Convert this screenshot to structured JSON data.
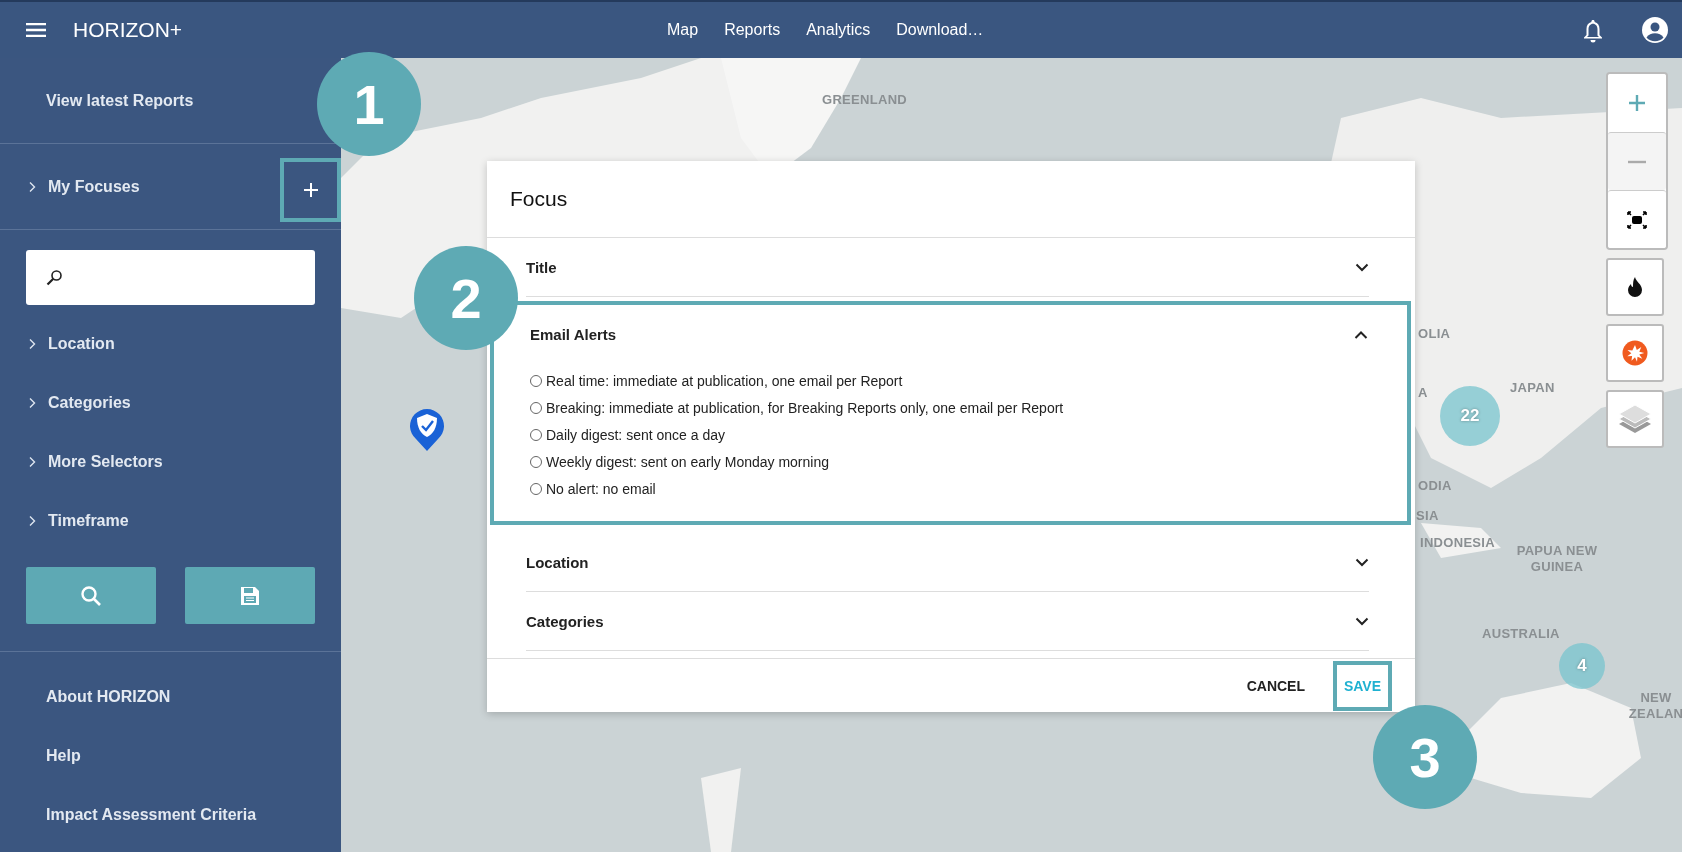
{
  "header": {
    "title": "HORIZON+",
    "nav": [
      "Map",
      "Reports",
      "Analytics",
      "Download…"
    ]
  },
  "sidebar": {
    "top_link": "View latest Reports",
    "focuses": {
      "label": "My Focuses",
      "expanded": false
    },
    "filters": [
      {
        "label": "Location",
        "expanded": false
      },
      {
        "label": "Categories",
        "expanded": false
      },
      {
        "label": "More Selectors",
        "expanded": false
      },
      {
        "label": "Timeframe",
        "expanded": false
      }
    ],
    "links": [
      "About HORIZON",
      "Help",
      "Impact Assessment Criteria"
    ]
  },
  "map": {
    "labels": [
      "GREENLAND",
      "OLIA",
      "A",
      "JAPAN",
      "ODIA",
      "SIA",
      "INDONESIA",
      "PAPUA NEW GUINEA",
      "AUSTRALIA",
      "NEW ZEALAN"
    ],
    "clusters": [
      "22",
      "4"
    ]
  },
  "dialog": {
    "title": "Focus",
    "sections": [
      {
        "title": "Title",
        "expanded": false
      },
      {
        "title": "Email Alerts",
        "expanded": true,
        "options": [
          {
            "label": "Real time: immediate at publication, one email per Report",
            "selected": false
          },
          {
            "label": "Breaking: immediate at publication, for Breaking Reports only, one email per Report",
            "selected": false
          },
          {
            "label": "Daily digest: sent once a day",
            "selected": false
          },
          {
            "label": "Weekly digest: sent on early Monday morning",
            "selected": false
          },
          {
            "label": "No alert: no email",
            "selected": false
          }
        ]
      },
      {
        "title": "Location",
        "expanded": false
      },
      {
        "title": "Categories",
        "expanded": false
      }
    ],
    "buttons": [
      "CANCEL",
      "SAVE"
    ]
  },
  "callouts": [
    "1",
    "2",
    "3"
  ]
}
